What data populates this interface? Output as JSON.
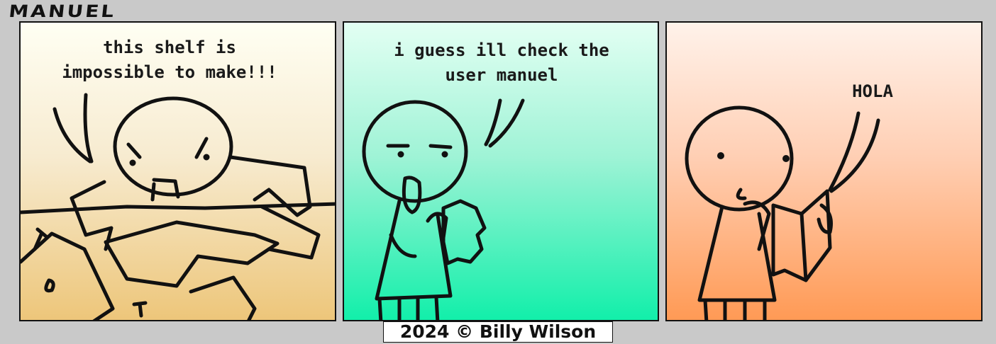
{
  "comic": {
    "title": "MANUEL",
    "panels": [
      {
        "caption": "this shelf is\nimpossible to make!!!"
      },
      {
        "caption": "i guess ill check the\nuser manuel"
      },
      {
        "caption": "HOLA"
      }
    ],
    "copyright": "2024 © Billy Wilson"
  }
}
